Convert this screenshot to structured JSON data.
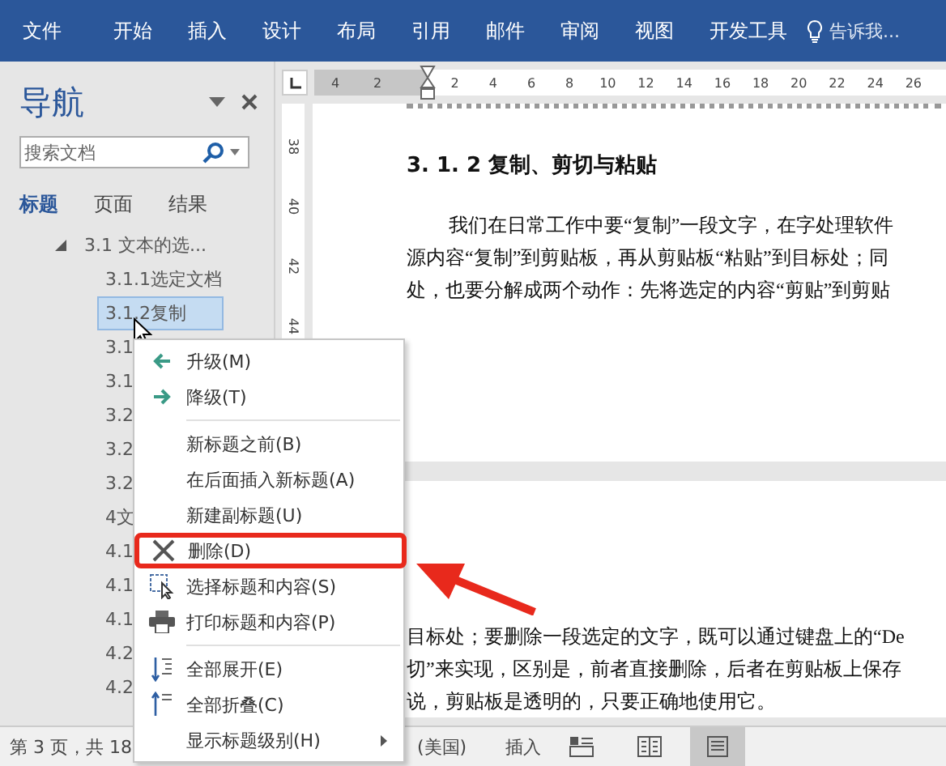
{
  "ribbon": {
    "tabs": [
      "文件",
      "开始",
      "插入",
      "设计",
      "布局",
      "引用",
      "邮件",
      "审阅",
      "视图",
      "开发工具"
    ],
    "tell_me": "告诉我..."
  },
  "nav": {
    "title": "导航",
    "search": {
      "placeholder": "搜索文档"
    },
    "tabs": [
      {
        "label": "标题",
        "selected": true
      },
      {
        "label": "页面",
        "selected": false
      },
      {
        "label": "结果",
        "selected": false
      }
    ],
    "tree": [
      {
        "label": "3.1 文本的选...",
        "expanded": true,
        "selected": false,
        "children": [
          {
            "label": "3.1.1选定文档",
            "selected": false
          },
          {
            "label": "3.1.2复制",
            "selected": true
          },
          {
            "label": "3.1",
            "selected": false
          },
          {
            "label": "3.1",
            "selected": false
          },
          {
            "label": "3.2",
            "selected": false
          },
          {
            "label": "3.2",
            "selected": false
          },
          {
            "label": "3.2",
            "selected": false
          },
          {
            "label": "4文",
            "selected": false
          },
          {
            "label": "4.1",
            "selected": false
          },
          {
            "label": "4.1",
            "selected": false
          },
          {
            "label": "4.1",
            "selected": false
          },
          {
            "label": "4.2",
            "selected": false
          },
          {
            "label": "4.2",
            "selected": false
          }
        ]
      }
    ]
  },
  "ruler": {
    "shaded": [
      "4",
      "2"
    ],
    "marks": [
      "2",
      "4",
      "6",
      "8",
      "10",
      "12",
      "14",
      "16",
      "18",
      "20",
      "22",
      "24",
      "26"
    ],
    "vertical": [
      "38",
      "40",
      "42",
      "44"
    ]
  },
  "document": {
    "heading": "3. 1. 2 复制、剪切与粘贴",
    "lines": [
      "我们在日常工作中要“复制”一段文字，在字处理软件",
      "源内容“复制”到剪贴板，再从剪贴板“粘贴”到目标处；同",
      "处，也要分解成两个动作：先将选定的内容“剪贴”到剪贴"
    ],
    "page2_lines": [
      "目标处；要删除一段选定的文字，既可以通过键盘上的“De",
      "切”来实现，区别是，前者直接删除，后者在剪贴板上保存",
      "说，剪贴板是透明的，只要正确地使用它。"
    ]
  },
  "context_menu": [
    {
      "kind": "item",
      "label": "升级(M)",
      "annotated": false,
      "submenu": false
    },
    {
      "kind": "item",
      "label": "降级(T)",
      "annotated": false,
      "submenu": false
    },
    {
      "kind": "separator"
    },
    {
      "kind": "item",
      "label": "新标题之前(B)",
      "annotated": false,
      "submenu": false
    },
    {
      "kind": "item",
      "label": "在后面插入新标题(A)",
      "annotated": false,
      "submenu": false
    },
    {
      "kind": "item",
      "label": "新建副标题(U)",
      "annotated": false,
      "submenu": false
    },
    {
      "kind": "item",
      "label": "删除(D)",
      "annotated": true,
      "submenu": false
    },
    {
      "kind": "item",
      "label": "选择标题和内容(S)",
      "annotated": false,
      "submenu": false
    },
    {
      "kind": "item",
      "label": "打印标题和内容(P)",
      "annotated": false,
      "submenu": false
    },
    {
      "kind": "separator"
    },
    {
      "kind": "item",
      "label": "全部展开(E)",
      "annotated": false,
      "submenu": false
    },
    {
      "kind": "item",
      "label": "全部折叠(C)",
      "annotated": false,
      "submenu": false
    },
    {
      "kind": "item",
      "label": "显示标题级别(H)",
      "annotated": false,
      "submenu": true
    }
  ],
  "status_bar": {
    "page": "第 3 页，共 18",
    "language": "(美国)",
    "mode": "插入",
    "views": [
      {
        "selected": false
      },
      {
        "selected": false
      },
      {
        "selected": true
      }
    ]
  }
}
